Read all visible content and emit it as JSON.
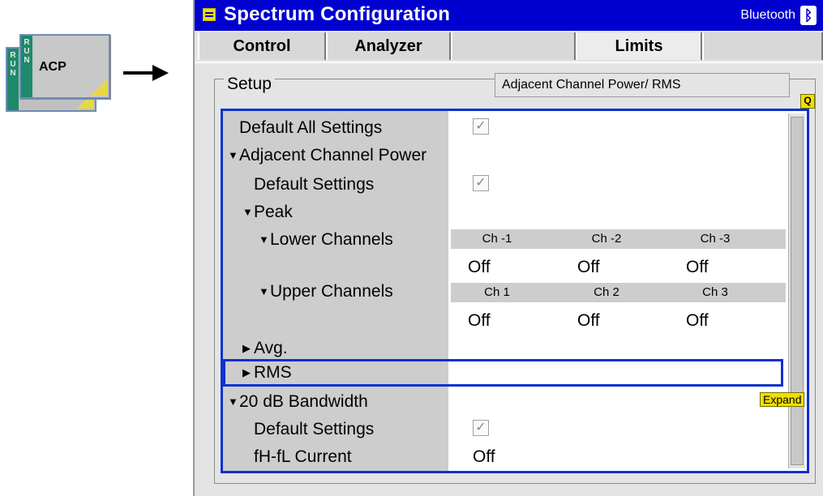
{
  "softkey": {
    "run_letters": [
      "R",
      "U",
      "N"
    ],
    "label": "ACP"
  },
  "title": {
    "text": "Spectrum Configuration",
    "right": "Bluetooth"
  },
  "tabs": [
    "Control",
    "Analyzer",
    "",
    "Limits",
    ""
  ],
  "setup": {
    "label": "Setup",
    "mode": "Adjacent Channel Power/ RMS"
  },
  "rows": {
    "default_all": "Default All Settings",
    "acp": "Adjacent Channel Power",
    "acp_default": "Default Settings",
    "peak": "Peak",
    "lower": "Lower Channels",
    "upper": "Upper Channels",
    "avg": "Avg.",
    "rms": "RMS",
    "bw20": "20 dB Bandwidth",
    "bw_default": "Default Settings",
    "fh_fl": "fH-fL Current"
  },
  "lower_headers": [
    "Ch -1",
    "Ch -2",
    "Ch -3"
  ],
  "lower_values": [
    "Off",
    "Off",
    "Off"
  ],
  "upper_headers": [
    "Ch 1",
    "Ch 2",
    "Ch 3"
  ],
  "upper_values": [
    "Off",
    "Off",
    "Off"
  ],
  "fh_fl_value": "Off",
  "checkmark": "✓",
  "expand_label": "Expand",
  "q_icon": "Q",
  "icons": [
    "menu-icon",
    "bluetooth-icon",
    "q-icon",
    "checkbox-icon",
    "arrow-right-icon",
    "triangle-down-icon",
    "triangle-right-icon"
  ],
  "colors": {
    "title_bar": "#0000d0",
    "selection": "#1030d0",
    "badge": "#f0e000",
    "run_bar": "#1d8a6a"
  }
}
